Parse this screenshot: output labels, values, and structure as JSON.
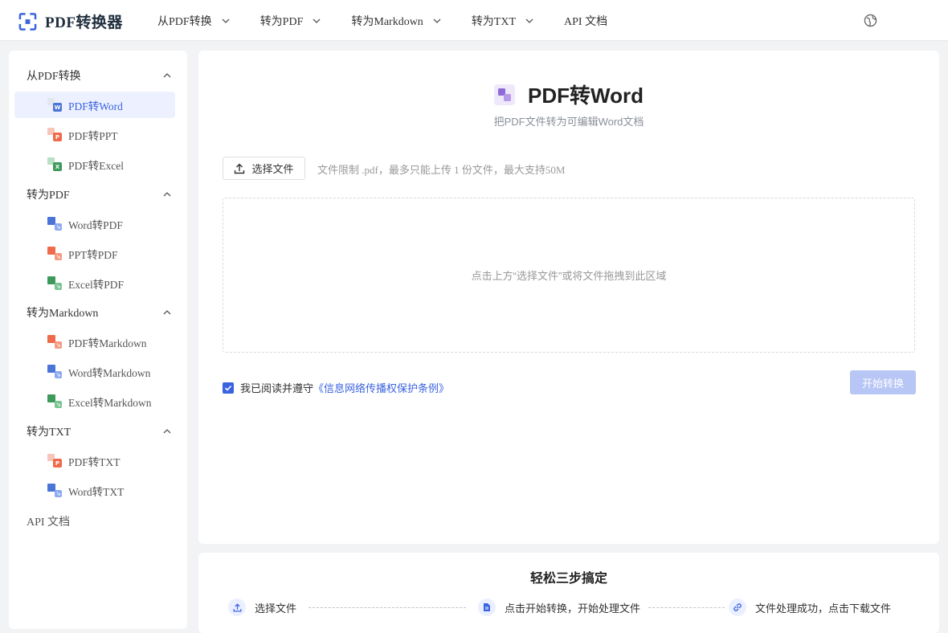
{
  "header": {
    "logo_text": "PDF转换器",
    "nav": [
      {
        "label": "从PDF转换",
        "has_dropdown": true
      },
      {
        "label": "转为PDF",
        "has_dropdown": true
      },
      {
        "label": "转为Markdown",
        "has_dropdown": true
      },
      {
        "label": "转为TXT",
        "has_dropdown": true
      },
      {
        "label": "API 文档",
        "has_dropdown": false
      }
    ],
    "globe_icon": "globe-icon"
  },
  "sidebar": {
    "groups": [
      {
        "title": "从PDF转换",
        "items": [
          {
            "label": "PDF转Word",
            "icon": "W",
            "active": true
          },
          {
            "label": "PDF转PPT",
            "icon": "P"
          },
          {
            "label": "PDF转Excel",
            "icon": "X"
          }
        ]
      },
      {
        "title": "转为PDF",
        "items": [
          {
            "label": "Word转PDF",
            "icon": "W"
          },
          {
            "label": "PPT转PDF",
            "icon": "P"
          },
          {
            "label": "Excel转PDF",
            "icon": "X"
          }
        ]
      },
      {
        "title": "转为Markdown",
        "items": [
          {
            "label": "PDF转Markdown",
            "icon": "P"
          },
          {
            "label": "Word转Markdown",
            "icon": "W"
          },
          {
            "label": "Excel转Markdown",
            "icon": "X"
          }
        ]
      },
      {
        "title": "转为TXT",
        "items": [
          {
            "label": "PDF转TXT",
            "icon": "P"
          },
          {
            "label": "Word转TXT",
            "icon": "W"
          }
        ]
      }
    ],
    "api_label": "API 文档"
  },
  "main": {
    "title": "PDF转Word",
    "subtitle": "把PDF文件转为可编辑Word文档",
    "choose_label": "选择文件",
    "limit_text": "文件限制 .pdf，最多只能上传 1 份文件，最大支持50M",
    "dropzone_text": "点击上方“选择文件”或将文件拖拽到此区域",
    "agree_prefix": "我已阅读并遵守",
    "agree_link": "《信息网络传播权保护条例》",
    "agree_checked": true,
    "start_label": "开始转换"
  },
  "steps": {
    "title": "轻松三步搞定",
    "items": [
      {
        "label": "选择文件",
        "icon": "upload-icon"
      },
      {
        "label": "点击开始转换，开始处理文件",
        "icon": "file-icon"
      },
      {
        "label": "文件处理成功，点击下载文件",
        "icon": "link-icon"
      }
    ]
  },
  "colors": {
    "accent": "#3a63e0",
    "accent_light": "#edf1ff",
    "word": "#4a74d6",
    "ppt": "#ee6a4a",
    "excel": "#3d9a5a",
    "disabled_button": "#b7c6f5"
  }
}
